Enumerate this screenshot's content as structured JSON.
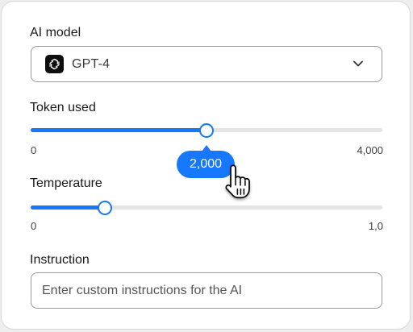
{
  "model": {
    "label": "AI model",
    "selected": "GPT-4",
    "icon": "openai-logo-icon",
    "chevron_icon": "chevron-down-icon"
  },
  "tokens": {
    "label": "Token used",
    "value": 2000,
    "min_label": "0",
    "max_label": "4,000",
    "value_label": "2,000",
    "fraction": 0.5,
    "accent": "#1677ff"
  },
  "temperature": {
    "label": "Temperature",
    "min_label": "0",
    "max_label": "1,0",
    "fraction": 0.21
  },
  "instruction": {
    "label": "Instruction",
    "placeholder": "Enter custom instructions for the AI"
  },
  "cursor_icon": "hand-pointer-icon"
}
